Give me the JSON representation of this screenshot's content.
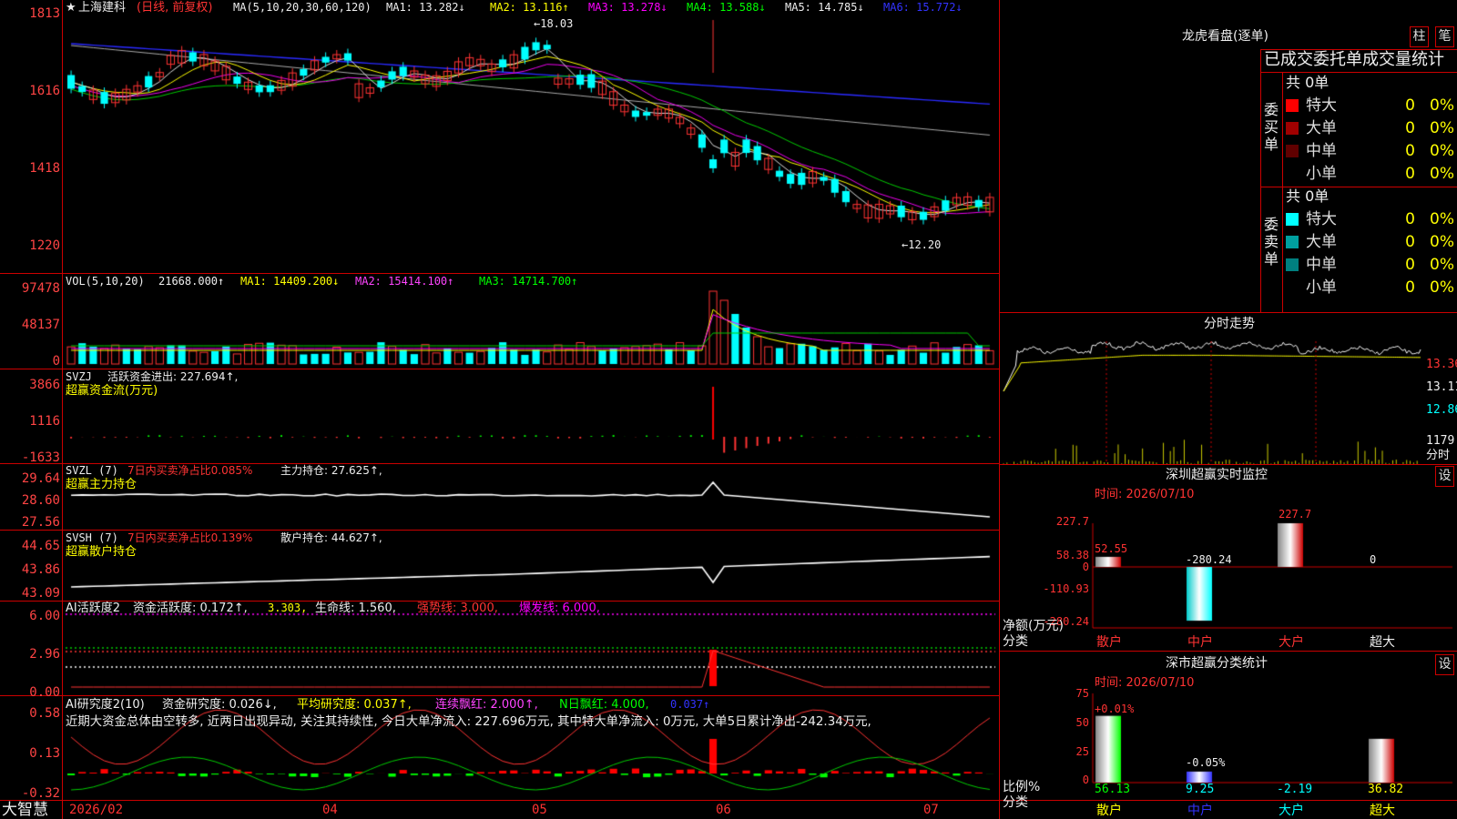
{
  "main_chart": {
    "star": "★",
    "stock_name": "上海建科",
    "period_note": "(日线, 前复权)",
    "ma_label": "MA(5,10,20,30,60,120)",
    "ma1": "MA1: 13.282↓",
    "ma2": "MA2: 13.116↑",
    "ma3": "MA3: 13.278↓",
    "ma4": "MA4: 13.588↓",
    "ma5": "MA5: 14.785↓",
    "ma6": "MA6: 15.772↓",
    "high_label": "←18.03",
    "low_label": "←12.20",
    "y_ticks": [
      "1813",
      "1616",
      "1418",
      "1220"
    ]
  },
  "vol_panel": {
    "title": "VOL(5,10,20)",
    "value": "21668.000↑",
    "ma1": "MA1: 14409.200↓",
    "ma2": "MA2: 15414.100↑",
    "ma3": "MA3: 14714.700↑",
    "y_ticks": [
      "97478",
      "48137",
      "0"
    ]
  },
  "svzj_panel": {
    "title": "SVZJ",
    "line1": "活跃资金进出: 227.694↑,",
    "line2": "超赢资金流(万元)",
    "y_ticks": [
      "3866",
      "1116",
      "-1633"
    ]
  },
  "svzl_panel": {
    "title": "SVZL (7)",
    "ratio": "7日内买卖净占比0.085%",
    "hold": "主力持仓: 27.625↑,",
    "sub": "超赢主力持仓",
    "y_ticks": [
      "29.64",
      "28.60",
      "27.56"
    ]
  },
  "svsh_panel": {
    "title": "SVSH (7)",
    "ratio": "7日内买卖净占比0.139%",
    "hold": "散户持仓: 44.627↑,",
    "sub": "超赢散户持仓",
    "y_ticks": [
      "44.65",
      "43.86",
      "43.09"
    ]
  },
  "ai_active_panel": {
    "title": "AI活跃度2",
    "activity": "资金活跃度: 0.172↑,",
    "v2": "3.303,",
    "life": "生命线: 1.560,",
    "strong": "强势线: 3.000,",
    "burst": "爆发线: 6.000,",
    "y_ticks": [
      "6.00",
      "2.96",
      "0.00"
    ]
  },
  "ai_research_panel": {
    "title": "AI研究度2(10)",
    "research": "资金研究度: 0.026↓,",
    "avg": "平均研究度: 0.037↑,",
    "cont": "连续飘红: 2.000↑,",
    "nday": "N日飘红: 4.000,",
    "v5": "0.037↑",
    "comment": "近期大资金总体由空转多, 近两日出现异动, 关注其持续性, 今日大单净流入: 227.696万元, 其中特大单净流入: 0万元, 大单5日累计净出-242.34万元,",
    "y_ticks": [
      "0.58",
      "0.13",
      "-0.32"
    ]
  },
  "time_axis": {
    "brand": "大智慧",
    "labels": [
      "2026/02",
      "04",
      "05",
      "06",
      "07"
    ]
  },
  "longhu": {
    "title": "龙虎看盘(逐单)",
    "btn_bar": "柱",
    "btn_line": "笔",
    "header": "已成交委托单成交量统计",
    "buy_label": "委买单",
    "sell_label": "委卖单",
    "buy_total": "共 0单",
    "sell_total": "共 0单",
    "buy_rows": [
      {
        "name": "特大",
        "count": "0",
        "pct": "0%",
        "color": "#ff0000"
      },
      {
        "name": "大单",
        "count": "0",
        "pct": "0%",
        "color": "#a00000"
      },
      {
        "name": "中单",
        "count": "0",
        "pct": "0%",
        "color": "#600000"
      },
      {
        "name": "小单",
        "count": "0",
        "pct": "0%",
        "color": ""
      }
    ],
    "sell_rows": [
      {
        "name": "特大",
        "count": "0",
        "pct": "0%",
        "color": "#00ffff"
      },
      {
        "name": "大单",
        "count": "0",
        "pct": "0%",
        "color": "#00a0a0"
      },
      {
        "name": "中单",
        "count": "0",
        "pct": "0%",
        "color": "#008080"
      },
      {
        "name": "小单",
        "count": "0",
        "pct": "0%",
        "color": ""
      }
    ]
  },
  "intraday": {
    "title": "分时走势",
    "y_ticks": [
      "13.36",
      "13.11",
      "12.86"
    ],
    "vol_tick": "1179",
    "vol_unit": "分时"
  },
  "sz_monitor": {
    "title": "深圳超赢实时监控",
    "btn": "设",
    "time": "时间: 2026/07/10",
    "y_ticks": [
      "227.7",
      "58.38",
      "0",
      "-110.93",
      "-280.24"
    ],
    "unit": "净额(万元)",
    "cat_label": "分类",
    "categories": [
      "散户",
      "中户",
      "大户",
      "超大"
    ],
    "values": [
      "52.55",
      "-280.24",
      "227.7",
      "0"
    ]
  },
  "sz_stats": {
    "title": "深市超赢分类统计",
    "btn": "设",
    "time": "时间: 2026/07/10",
    "y_ticks": [
      "75",
      "50",
      "25",
      "0"
    ],
    "unit": "比例%",
    "cat_label": "分类",
    "categories": [
      "散户",
      "中户",
      "大户",
      "超大"
    ],
    "values": [
      "56.13",
      "9.25",
      "-2.19",
      "36.82"
    ],
    "changes": [
      "+0.01%",
      "-0.05%",
      "",
      ""
    ]
  }
}
